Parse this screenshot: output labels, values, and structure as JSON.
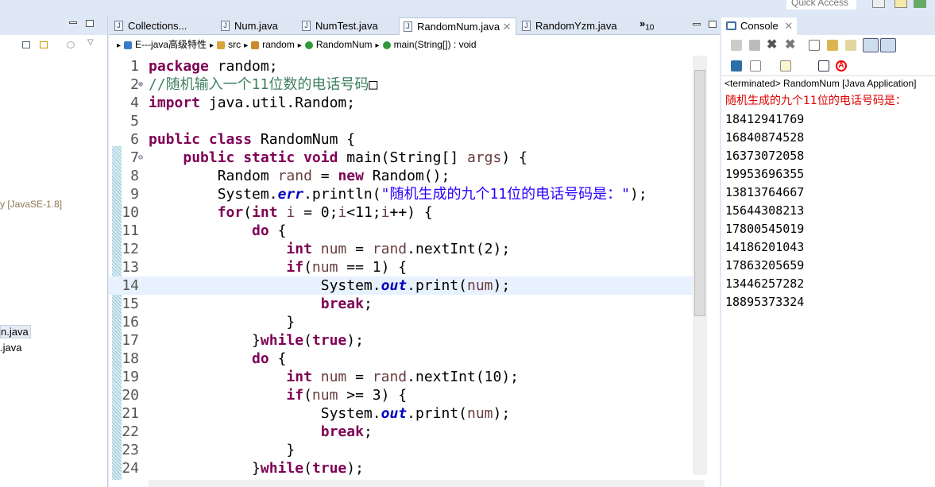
{
  "toolbar": {
    "quick_access": "Quick Access"
  },
  "left_panel": {
    "items": [
      "y [JavaSE-1.8]",
      "n.java",
      ".java"
    ]
  },
  "editor": {
    "tabs": [
      {
        "label": "Collections...",
        "active": false
      },
      {
        "label": "Num.java",
        "active": false
      },
      {
        "label": "NumTest.java",
        "active": false
      },
      {
        "label": "RandomNum.java",
        "active": true
      },
      {
        "label": "RandomYzm.java",
        "active": false
      }
    ],
    "overflow_count": "10",
    "breadcrumb": [
      "E---java高级特性",
      "src",
      "random",
      "RandomNum",
      "main(String[]) : void"
    ],
    "current_line": 14,
    "lines": [
      {
        "n": "1",
        "t": [
          [
            "k",
            "package"
          ],
          [
            "",
            "random;"
          ]
        ]
      },
      {
        "n": "2",
        "t": [
          [
            "c",
            "//随机输入一个11位数的电话号码"
          ],
          [
            "",
            "□"
          ]
        ]
      },
      {
        "n": "4",
        "t": [
          [
            "k",
            "import"
          ],
          [
            "",
            " java.util.Random;"
          ]
        ]
      },
      {
        "n": "5",
        "t": []
      },
      {
        "n": "6",
        "t": [
          [
            "k",
            "public class"
          ],
          [
            "",
            " RandomNum {"
          ]
        ]
      },
      {
        "n": "7",
        "t": [
          [
            "",
            "    "
          ],
          [
            "k",
            "public static void"
          ],
          [
            "",
            " main(String[] "
          ],
          [
            "v",
            "args"
          ],
          [
            "",
            ") {"
          ]
        ]
      },
      {
        "n": "8",
        "t": [
          [
            "",
            "        Random "
          ],
          [
            "v",
            "rand"
          ],
          [
            "",
            " = "
          ],
          [
            "k",
            "new"
          ],
          [
            "",
            " Random();"
          ]
        ]
      },
      {
        "n": "9",
        "t": [
          [
            "",
            "        System."
          ],
          [
            "f",
            "err"
          ],
          [
            "",
            ".println("
          ],
          [
            "s",
            "\"随机生成的九个11位的电话号码是：\""
          ],
          [
            "",
            ");"
          ]
        ]
      },
      {
        "n": "10",
        "t": [
          [
            "",
            "        "
          ],
          [
            "k",
            "for"
          ],
          [
            "",
            "("
          ],
          [
            "k",
            "int"
          ],
          [
            "",
            " "
          ],
          [
            "v",
            "i"
          ],
          [
            "",
            " = 0;"
          ],
          [
            "v",
            "i"
          ],
          [
            "",
            "<11;"
          ],
          [
            "v",
            "i"
          ],
          [
            "",
            "++) {"
          ]
        ]
      },
      {
        "n": "11",
        "t": [
          [
            "",
            "            "
          ],
          [
            "k",
            "do"
          ],
          [
            "",
            " {"
          ]
        ]
      },
      {
        "n": "12",
        "t": [
          [
            "",
            "                "
          ],
          [
            "k",
            "int"
          ],
          [
            "",
            " "
          ],
          [
            "v",
            "num"
          ],
          [
            "",
            " = "
          ],
          [
            "v",
            "rand"
          ],
          [
            "",
            ".nextInt(2);"
          ]
        ]
      },
      {
        "n": "13",
        "t": [
          [
            "",
            "                "
          ],
          [
            "k",
            "if"
          ],
          [
            "",
            "("
          ],
          [
            "v",
            "num"
          ],
          [
            "",
            " == 1) {"
          ]
        ]
      },
      {
        "n": "14",
        "t": [
          [
            "",
            "                    System."
          ],
          [
            "f",
            "out"
          ],
          [
            "",
            ".print("
          ],
          [
            "v",
            "num"
          ],
          [
            "",
            ");"
          ]
        ]
      },
      {
        "n": "15",
        "t": [
          [
            "",
            "                    "
          ],
          [
            "k",
            "break"
          ],
          [
            "",
            ";"
          ]
        ]
      },
      {
        "n": "16",
        "t": [
          [
            "",
            "                }"
          ]
        ]
      },
      {
        "n": "17",
        "t": [
          [
            "",
            "            }"
          ],
          [
            "k",
            "while"
          ],
          [
            "",
            "("
          ],
          [
            "k",
            "true"
          ],
          [
            "",
            ");"
          ]
        ]
      },
      {
        "n": "18",
        "t": [
          [
            "",
            "            "
          ],
          [
            "k",
            "do"
          ],
          [
            "",
            " {"
          ]
        ]
      },
      {
        "n": "19",
        "t": [
          [
            "",
            "                "
          ],
          [
            "k",
            "int"
          ],
          [
            "",
            " "
          ],
          [
            "v",
            "num"
          ],
          [
            "",
            " = "
          ],
          [
            "v",
            "rand"
          ],
          [
            "",
            ".nextInt(10);"
          ]
        ]
      },
      {
        "n": "20",
        "t": [
          [
            "",
            "                "
          ],
          [
            "k",
            "if"
          ],
          [
            "",
            "("
          ],
          [
            "v",
            "num"
          ],
          [
            "",
            " >= 3) {"
          ]
        ]
      },
      {
        "n": "21",
        "t": [
          [
            "",
            "                    System."
          ],
          [
            "f",
            "out"
          ],
          [
            "",
            ".print("
          ],
          [
            "v",
            "num"
          ],
          [
            "",
            ");"
          ]
        ]
      },
      {
        "n": "22",
        "t": [
          [
            "",
            "                    "
          ],
          [
            "k",
            "break"
          ],
          [
            "",
            ";"
          ]
        ]
      },
      {
        "n": "23",
        "t": [
          [
            "",
            "                }"
          ]
        ]
      },
      {
        "n": "24",
        "t": [
          [
            "",
            "            }"
          ],
          [
            "k",
            "while"
          ],
          [
            "",
            "("
          ],
          [
            "k",
            "true"
          ],
          [
            "",
            ");"
          ]
        ]
      }
    ]
  },
  "console": {
    "tab_label": "Console",
    "status": "<terminated> RandomNum [Java Application]",
    "header_line": "随机生成的九个11位的电话号码是：",
    "output": [
      "18412941769",
      "16840874528",
      "16373072058",
      "19953696355",
      "13813764667",
      "15644308213",
      "17800545019",
      "14186201043",
      "17863205659",
      "13446257282",
      "18895373324"
    ]
  },
  "colors": {
    "keyword": "#7f0055",
    "comment": "#3f7f5f",
    "string": "#2a00ff",
    "field": "#0000c0",
    "stderr": "#e00000",
    "current_line": "#e8f2fe"
  }
}
